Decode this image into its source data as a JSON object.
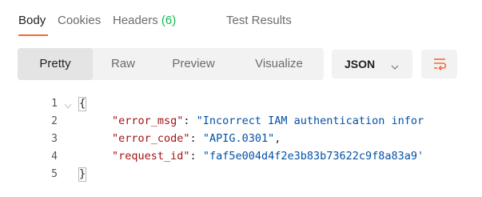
{
  "tabs": [
    {
      "label": "Body",
      "active": true
    },
    {
      "label": "Cookies",
      "active": false
    },
    {
      "label": "Headers",
      "count": "(6)",
      "active": false
    },
    {
      "label": "Test Results",
      "active": false
    }
  ],
  "view_modes": [
    {
      "label": "Pretty",
      "active": true
    },
    {
      "label": "Raw",
      "active": false
    },
    {
      "label": "Preview",
      "active": false
    },
    {
      "label": "Visualize",
      "active": false
    }
  ],
  "format": {
    "selected": "JSON"
  },
  "icons": {
    "wrap": "wrap-lines-icon",
    "chevron": "chevron-down-icon",
    "fold": "fold-arrow-icon"
  },
  "colors": {
    "accent": "#f26b3a",
    "count_green": "#0cbb52",
    "key": "#a31515",
    "string": "#0451a5"
  },
  "editor": {
    "lines": [
      {
        "num": "1",
        "open": "{"
      },
      {
        "num": "2",
        "key": "\"error_msg\"",
        "sep": ": ",
        "value": "\"Incorrect IAM authentication infor"
      },
      {
        "num": "3",
        "key": "\"error_code\"",
        "sep": ": ",
        "value": "\"APIG.0301\"",
        "comma": ","
      },
      {
        "num": "4",
        "key": "\"request_id\"",
        "sep": ": ",
        "value": "\"faf5e004d4f2e3b83b73622c9f8a83a9'"
      },
      {
        "num": "5",
        "close": "}"
      }
    ]
  }
}
